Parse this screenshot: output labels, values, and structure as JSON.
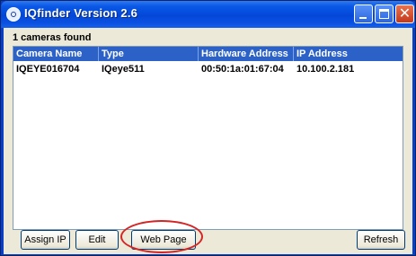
{
  "window": {
    "title": "IQfinder Version 2.6",
    "accent": "#0a58e6"
  },
  "status": {
    "count_label": "1 cameras found"
  },
  "table": {
    "columns": [
      "Camera Name",
      "Type",
      "Hardware Address",
      "IP Address"
    ],
    "rows": [
      [
        "IQEYE016704",
        "IQeye511",
        "00:50:1a:01:67:04",
        "10.100.2.181"
      ]
    ]
  },
  "buttons": {
    "assign_ip": "Assign IP",
    "edit": "Edit",
    "web_page": "Web Page",
    "refresh": "Refresh"
  },
  "highlight_color": "#d42525"
}
